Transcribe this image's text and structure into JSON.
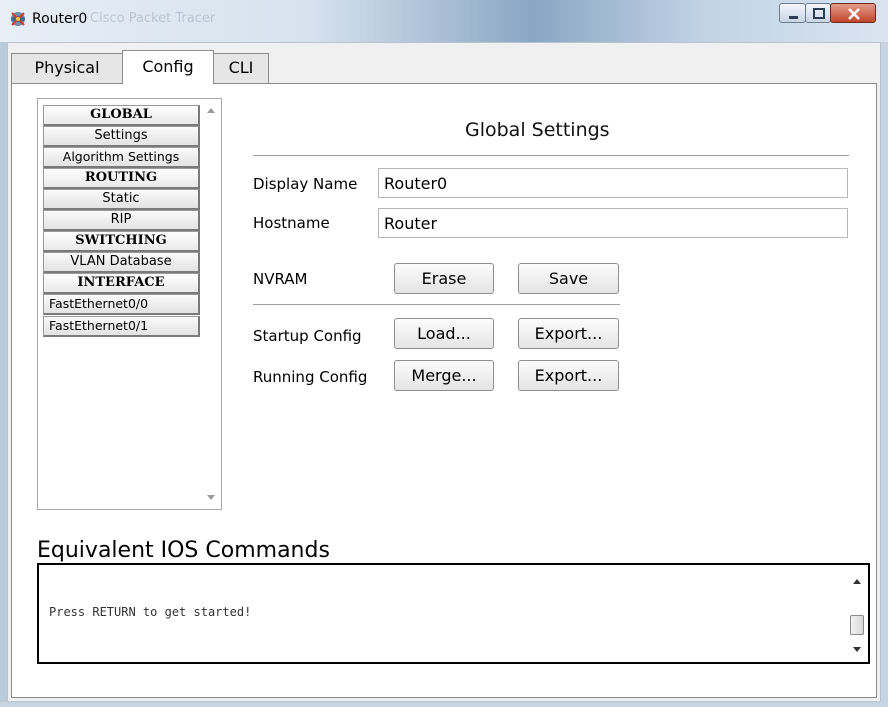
{
  "window": {
    "title": "Router0",
    "title_ghost": "Cisco Packet Tracer",
    "controls": [
      "minimize",
      "maximize",
      "close"
    ]
  },
  "tabs": [
    {
      "label": "Physical",
      "active": false
    },
    {
      "label": "Config",
      "active": true
    },
    {
      "label": "CLI",
      "active": false
    }
  ],
  "sidebar": {
    "items": [
      {
        "label": "GLOBAL",
        "type": "header"
      },
      {
        "label": "Settings",
        "type": "item"
      },
      {
        "label": "Algorithm Settings",
        "type": "item"
      },
      {
        "label": "ROUTING",
        "type": "header"
      },
      {
        "label": "Static",
        "type": "item"
      },
      {
        "label": "RIP",
        "type": "item"
      },
      {
        "label": "SWITCHING",
        "type": "header"
      },
      {
        "label": "VLAN Database",
        "type": "item"
      },
      {
        "label": "INTERFACE",
        "type": "header"
      },
      {
        "label": "FastEthernet0/0",
        "type": "item"
      },
      {
        "label": "FastEthernet0/1",
        "type": "item"
      }
    ]
  },
  "global_settings": {
    "title": "Global Settings",
    "display_name": {
      "label": "Display Name",
      "value": "Router0"
    },
    "hostname": {
      "label": "Hostname",
      "value": "Router"
    },
    "nvram": {
      "label": "NVRAM",
      "erase": "Erase",
      "save": "Save"
    },
    "startup_config": {
      "label": "Startup Config",
      "load": "Load...",
      "export": "Export..."
    },
    "running_config": {
      "label": "Running Config",
      "merge": "Merge...",
      "export": "Export..."
    }
  },
  "ios_commands": {
    "title": "Equivalent IOS Commands",
    "console_text": "Press RETURN to get started!"
  },
  "colors": {
    "close_button": "#c2452b",
    "panel_background": "#ffffff",
    "frame_background": "#f0f0f0"
  }
}
